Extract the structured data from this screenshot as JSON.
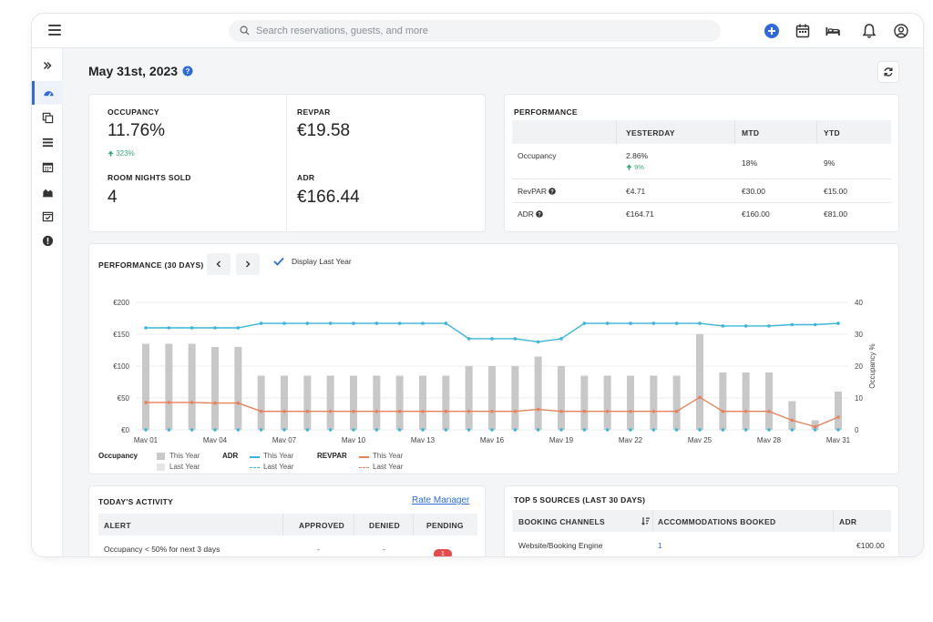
{
  "header": {
    "search_placeholder": "Search reservations, guests, and more"
  },
  "page": {
    "date_title": "May 31st, 2023"
  },
  "kpis": {
    "occupancy_label": "OCCUPANCY",
    "occupancy_value": "11.76%",
    "occupancy_change": "323%",
    "revpar_label": "REVPAR",
    "revpar_value": "€19.58",
    "room_nights_label": "ROOM NIGHTS SOLD",
    "room_nights_value": "4",
    "adr_label": "ADR",
    "adr_value": "€166.44"
  },
  "performance_table": {
    "title": "PERFORMANCE",
    "columns": [
      "",
      "YESTERDAY",
      "MTD",
      "YTD"
    ],
    "rows": [
      {
        "metric": "Occupancy",
        "yesterday": "2.86%",
        "yesterday_change": "9%",
        "mtd": "18%",
        "ytd": "9%"
      },
      {
        "metric": "RevPAR",
        "yesterday": "€4.71",
        "mtd": "€30.00",
        "ytd": "€15.00"
      },
      {
        "metric": "ADR",
        "yesterday": "€164.71",
        "mtd": "€160.00",
        "ytd": "€81.00"
      }
    ]
  },
  "chart_section": {
    "title": "PERFORMANCE (30 DAYS)",
    "display_last_year": "Display Last Year"
  },
  "chart_data": {
    "type": "bar",
    "x_tick_labels": [
      "May 01",
      "May 04",
      "May 07",
      "May 10",
      "May 13",
      "May 16",
      "May 19",
      "May 22",
      "May 25",
      "May 28",
      "May 31"
    ],
    "y_left_ticks": [
      "€200",
      "€150",
      "€100",
      "€50",
      "€0"
    ],
    "y_left_range": [
      0,
      200
    ],
    "y_right_ticks": [
      "40",
      "30",
      "20",
      "10",
      "0"
    ],
    "y_right_range": [
      0,
      40
    ],
    "y_right_label": "Occupancy %",
    "series": [
      {
        "name": "This Year",
        "group": "Occupancy",
        "kind": "bar",
        "color": "#c8c8c8",
        "values": [
          27,
          27,
          27,
          26,
          26,
          17,
          17,
          17,
          17,
          17,
          17,
          17,
          17,
          17,
          20,
          20,
          20,
          23,
          20,
          17,
          17,
          17,
          17,
          17,
          30,
          18,
          18,
          18,
          9,
          3,
          12
        ]
      },
      {
        "name": "This Year",
        "group": "ADR",
        "kind": "line",
        "color": "#3bb5d9",
        "values": [
          160,
          160,
          160,
          160,
          160,
          167,
          167,
          167,
          167,
          167,
          167,
          167,
          167,
          167,
          143,
          143,
          143,
          138,
          143,
          167,
          167,
          167,
          167,
          167,
          167,
          163,
          163,
          163,
          165,
          165,
          167
        ]
      },
      {
        "name": "This Year",
        "group": "REVPAR",
        "kind": "line",
        "color": "#e8825a",
        "values": [
          43,
          43,
          43,
          42,
          42,
          29,
          29,
          29,
          29,
          29,
          29,
          29,
          29,
          29,
          29,
          29,
          29,
          32,
          29,
          29,
          29,
          29,
          29,
          29,
          51,
          29,
          29,
          29,
          15,
          5,
          20
        ]
      },
      {
        "name": "Last Year",
        "group": "Occupancy",
        "kind": "bar",
        "color": "#e6e6e6",
        "values": []
      },
      {
        "name": "Last Year",
        "group": "ADR",
        "kind": "line-dashed",
        "color": "#3bb5d9",
        "values": []
      },
      {
        "name": "Last Year",
        "group": "REVPAR",
        "kind": "line-dashed",
        "color": "#e8825a",
        "values": []
      }
    ],
    "legend": {
      "groups": [
        "Occupancy",
        "ADR",
        "REVPAR"
      ],
      "this_year": "This Year",
      "last_year": "Last Year"
    },
    "legend_placement": "bottom-left"
  },
  "todays_activity": {
    "title": "TODAY'S ACTIVITY",
    "rate_manager": "Rate Manager",
    "columns": [
      "ALERT",
      "APPROVED",
      "DENIED",
      "PENDING"
    ],
    "rows": [
      {
        "alert": "Occupancy < 50% for next 3 days",
        "approved": "-",
        "denied": "-",
        "pending": "1"
      }
    ]
  },
  "top_sources": {
    "title": "TOP 5 SOURCES (LAST 30 DAYS)",
    "columns": [
      "BOOKING CHANNELS",
      "ACCOMMODATIONS BOOKED",
      "ADR"
    ],
    "rows": [
      {
        "channel": "Website/Booking Engine",
        "booked": "1",
        "adr": "€100.00"
      }
    ]
  },
  "colors": {
    "accent": "#2d6ae0",
    "teal": "#3bb5d9",
    "orange": "#e8825a",
    "green": "#3aa876",
    "alert": "#e44b4b"
  }
}
